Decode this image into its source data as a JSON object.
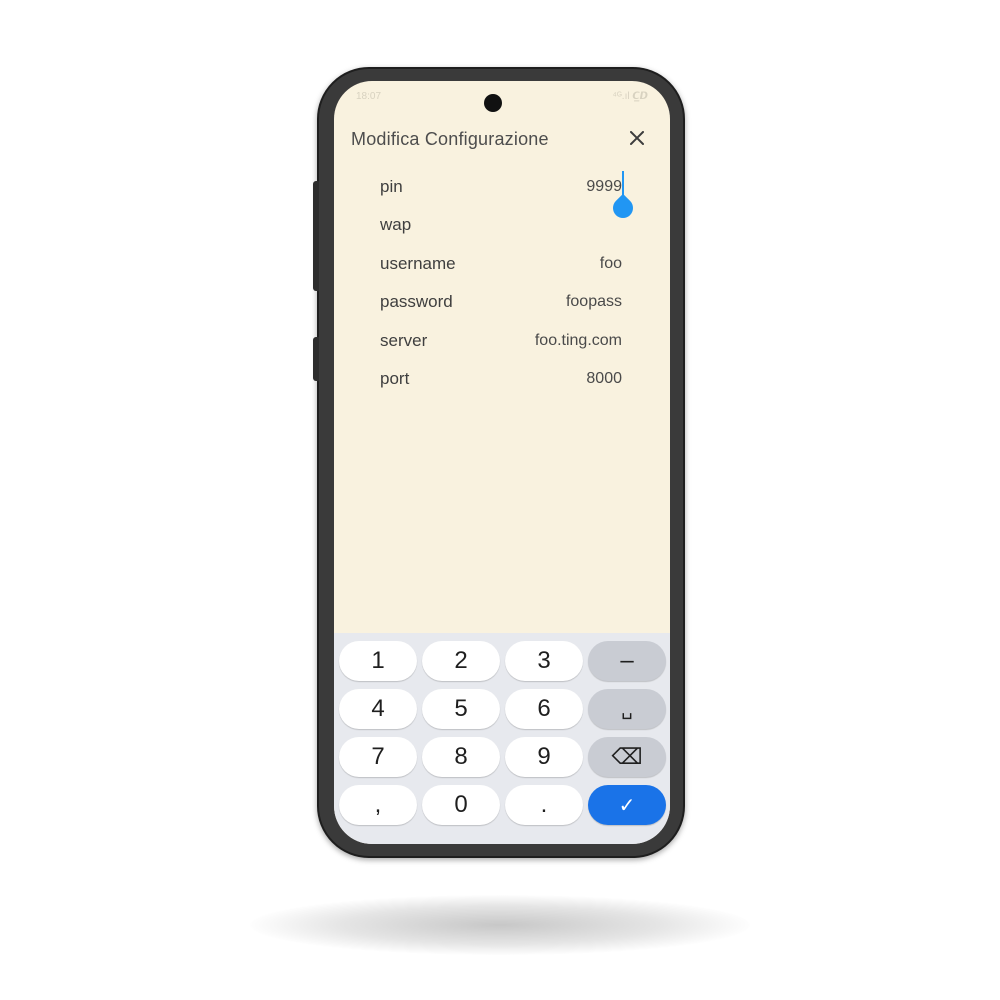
{
  "status_bar": {
    "time": "18:07",
    "icons": "⁴ᴳ.ıl 𝘾̲𝘿"
  },
  "dialog": {
    "title": "Modifica Configurazione",
    "close_icon": "close-icon"
  },
  "fields": [
    {
      "label": "pin",
      "value": "9999"
    },
    {
      "label": "wap",
      "value": ""
    },
    {
      "label": "username",
      "value": "foo"
    },
    {
      "label": "password",
      "value": "foopass"
    },
    {
      "label": "server",
      "value": "foo.ting.com"
    },
    {
      "label": "port",
      "value": "8000"
    }
  ],
  "keyboard": {
    "rows": [
      [
        "1",
        "2",
        "3",
        "–"
      ],
      [
        "4",
        "5",
        "6",
        "␣"
      ],
      [
        "7",
        "8",
        "9",
        "⌫"
      ],
      [
        ",",
        "0",
        ".",
        "✓"
      ]
    ],
    "accent_color": "#1a73e8"
  },
  "colors": {
    "screen_background": "#f9f2df",
    "cursor": "#2196f3"
  }
}
